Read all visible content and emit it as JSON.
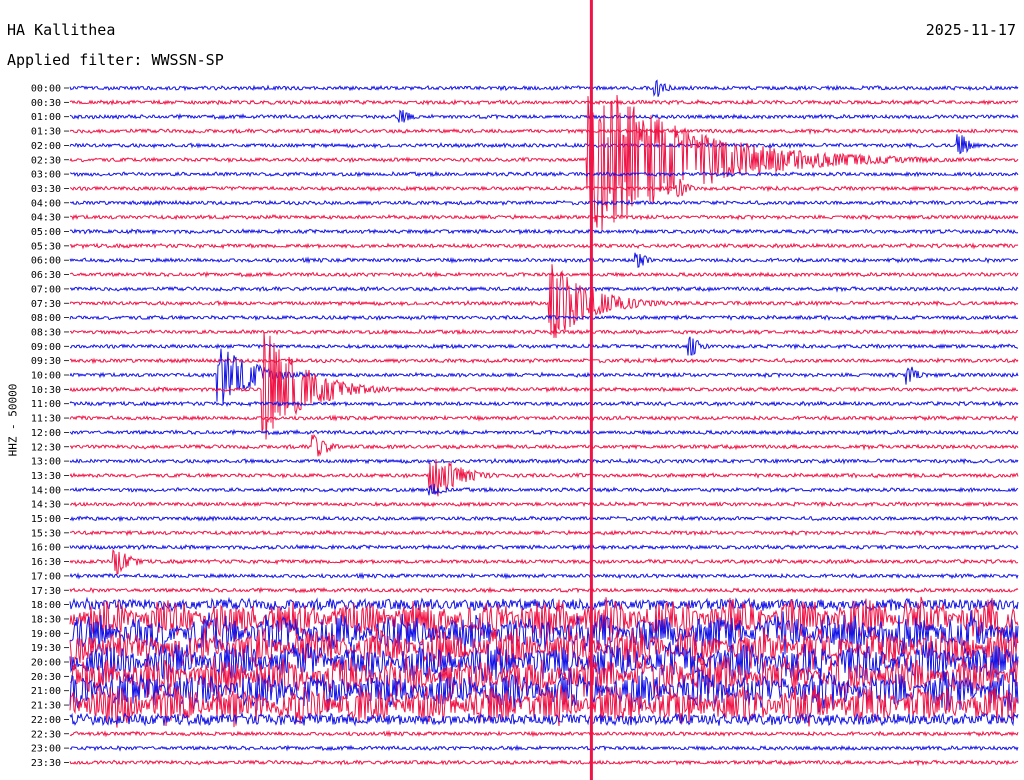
{
  "header": {
    "station": "HA Kallithea",
    "date": "2025-11-17",
    "filter": "Applied filter: WWSSN-SP"
  },
  "colors": {
    "even_rows": "#1414e6",
    "odd_rows": "#f01446"
  },
  "chart_data": {
    "type": "helicorder",
    "title": "HA Kallithea",
    "date": "2025-11-17",
    "filter": "WWSSN-SP",
    "ylabel": "HHZ - 50000",
    "ytick_labels": [
      "00:00",
      "00:30",
      "01:00",
      "01:30",
      "02:00",
      "02:30",
      "03:00",
      "03:30",
      "04:00",
      "04:30",
      "05:00",
      "05:30",
      "06:00",
      "06:30",
      "07:00",
      "07:30",
      "08:00",
      "08:30",
      "09:00",
      "09:30",
      "10:00",
      "10:30",
      "11:00",
      "11:30",
      "12:00",
      "12:30",
      "13:00",
      "13:30",
      "14:00",
      "14:30",
      "15:00",
      "15:30",
      "16:00",
      "16:30",
      "17:00",
      "17:30",
      "18:00",
      "18:30",
      "19:00",
      "19:30",
      "20:00",
      "20:30",
      "21:00",
      "21:30",
      "22:00",
      "22:30",
      "23:00",
      "23:30"
    ],
    "row_minutes": 30,
    "series_colors": [
      "blue",
      "red"
    ],
    "noisy_rows": {
      "from": "18:30",
      "to": "21:30",
      "level": 1.0
    },
    "events": [
      {
        "row": "02:30",
        "minute": 16.5,
        "amplitude": 8.5,
        "decay_minutes": 3.0,
        "note": "large event, saturated trace crossing many rows"
      },
      {
        "row": "07:30",
        "minute": 15.3,
        "amplitude": 4.0,
        "decay_minutes": 1.2
      },
      {
        "row": "10:00",
        "minute": 4.8,
        "amplitude": 3.2,
        "decay_minutes": 1.0
      },
      {
        "row": "10:30",
        "minute": 6.2,
        "amplitude": 6.0,
        "decay_minutes": 1.2
      },
      {
        "row": "13:30",
        "minute": 11.5,
        "amplitude": 2.5,
        "decay_minutes": 0.8
      },
      {
        "row": "16:30",
        "minute": 1.5,
        "amplitude": 1.3,
        "decay_minutes": 0.5
      },
      {
        "row": "12:30",
        "minute": 7.8,
        "amplitude": 1.3,
        "decay_minutes": 0.4
      },
      {
        "row": "02:00",
        "minute": 28.2,
        "amplitude": 1.2,
        "decay_minutes": 0.3
      },
      {
        "row": "00:00",
        "minute": 18.6,
        "amplitude": 1.0,
        "decay_minutes": 0.3
      },
      {
        "row": "03:30",
        "minute": 19.3,
        "amplitude": 1.0,
        "decay_minutes": 0.3
      },
      {
        "row": "09:00",
        "minute": 19.7,
        "amplitude": 1.0,
        "decay_minutes": 0.3
      },
      {
        "row": "10:00",
        "minute": 26.6,
        "amplitude": 1.0,
        "decay_minutes": 0.3
      },
      {
        "row": "06:00",
        "minute": 18.0,
        "amplitude": 0.9,
        "decay_minutes": 0.3
      },
      {
        "row": "01:00",
        "minute": 10.5,
        "amplitude": 0.8,
        "decay_minutes": 0.3
      },
      {
        "row": "14:00",
        "minute": 11.5,
        "amplitude": 0.7,
        "decay_minutes": 0.4
      }
    ]
  }
}
